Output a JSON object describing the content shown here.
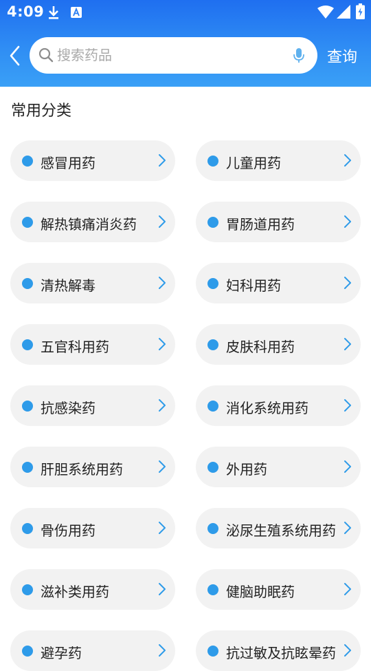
{
  "status_bar": {
    "time": "4:09",
    "icons": [
      "download-icon",
      "app-notification-icon",
      "wifi-icon",
      "signal-icon",
      "battery-icon"
    ]
  },
  "header": {
    "back_icon": "back-arrow-icon",
    "search": {
      "placeholder": "搜索药品",
      "value": "",
      "icon": "search-icon",
      "mic_icon": "microphone-icon"
    },
    "query_label": "查询"
  },
  "section_title": "常用分类",
  "categories": [
    {
      "label": "感冒用药"
    },
    {
      "label": "儿童用药"
    },
    {
      "label": "解热镇痛消炎药"
    },
    {
      "label": "胃肠道用药"
    },
    {
      "label": "清热解毒"
    },
    {
      "label": "妇科用药"
    },
    {
      "label": "五官科用药"
    },
    {
      "label": "皮肤科用药"
    },
    {
      "label": "抗感染药"
    },
    {
      "label": "消化系统用药"
    },
    {
      "label": "肝胆系统用药"
    },
    {
      "label": "外用药"
    },
    {
      "label": "骨伤用药"
    },
    {
      "label": "泌尿生殖系统用药"
    },
    {
      "label": "滋补类用药"
    },
    {
      "label": "健脑助眠药"
    },
    {
      "label": "避孕药"
    },
    {
      "label": "抗过敏及抗眩晕药"
    }
  ],
  "colors": {
    "header_gradient_top": "#1f6ff0",
    "header_gradient_bottom": "#3aa0f6",
    "dot": "#2e9be9",
    "chevron": "#2e9be9",
    "item_bg": "#f2f2f2"
  }
}
